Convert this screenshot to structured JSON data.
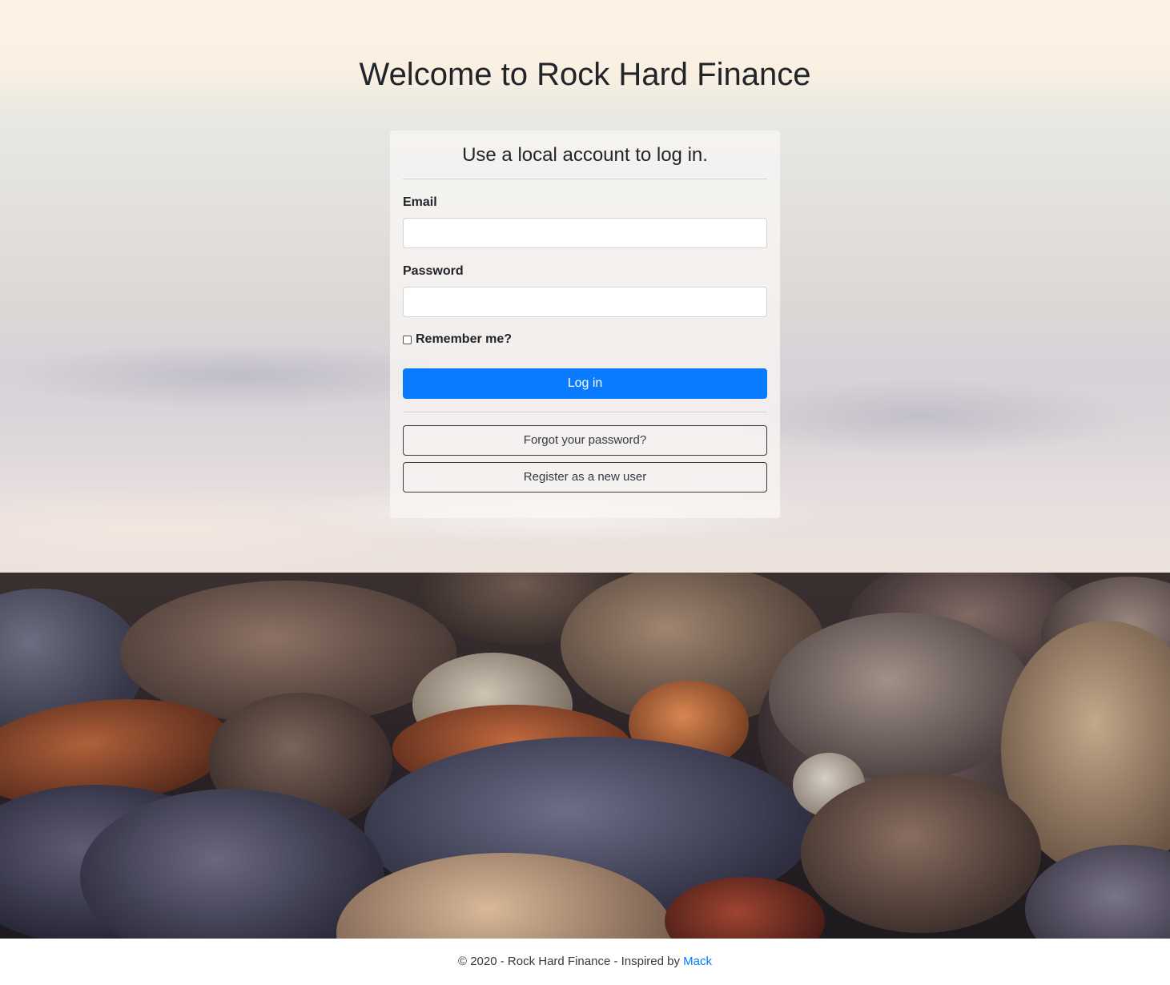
{
  "page": {
    "title": "Welcome to Rock Hard Finance"
  },
  "login_form": {
    "heading": "Use a local account to log in.",
    "email_label": "Email",
    "email_value": "",
    "password_label": "Password",
    "password_value": "",
    "remember_label": "Remember me?",
    "remember_checked": false,
    "login_button": "Log in",
    "forgot_link": "Forgot your password?",
    "register_link": "Register as a new user"
  },
  "footer": {
    "copyright": "© 2020 - Rock Hard Finance - Inspired by ",
    "link_text": "Mack"
  },
  "colors": {
    "primary": "#007bff",
    "text": "#212529",
    "link": "#007bff"
  }
}
